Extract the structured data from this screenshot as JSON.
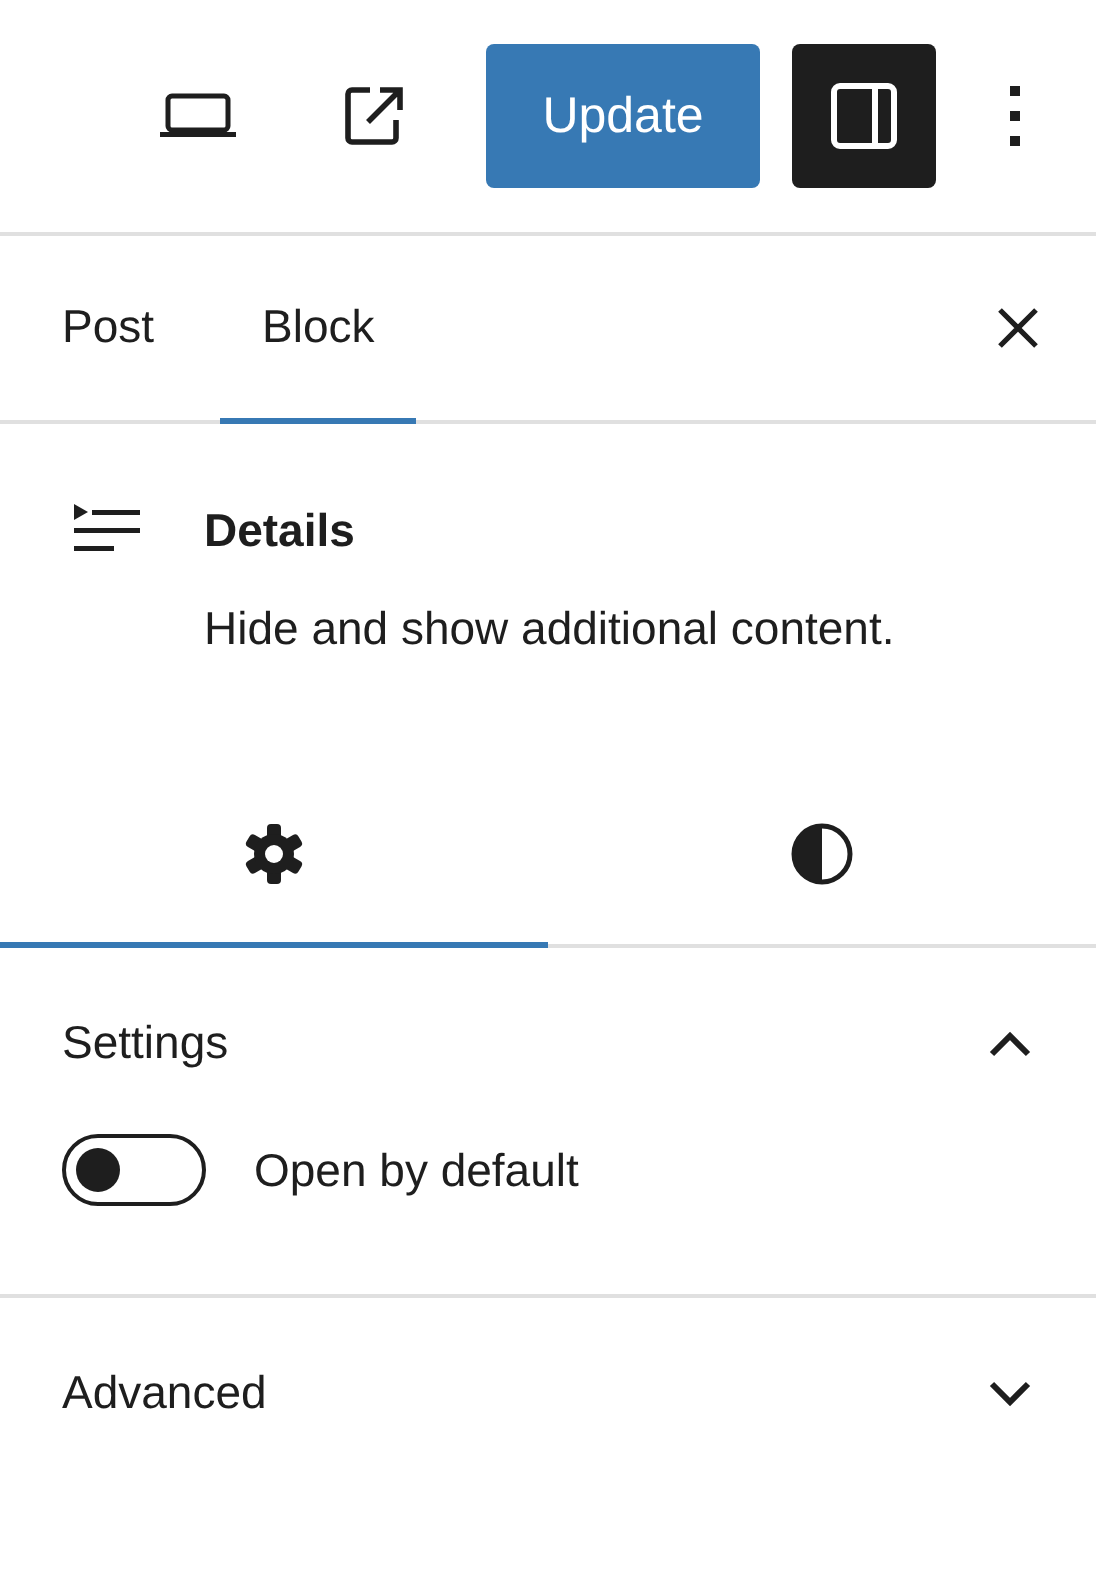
{
  "toolbar": {
    "update_button": "Update",
    "sidebar_toggle": {
      "selected": true
    }
  },
  "sidebar_tabs": [
    {
      "label": "Post",
      "selected": false
    },
    {
      "label": "Block",
      "selected": true
    }
  ],
  "block": {
    "title": "Details",
    "description": "Hide and show additional content."
  },
  "inspector_tabs": [
    {
      "kind": "settings",
      "selected": true
    },
    {
      "kind": "styles",
      "selected": false
    }
  ],
  "panels": [
    {
      "title": "Settings",
      "expanded": true,
      "toggles": [
        {
          "label": "Open by default",
          "on": false
        }
      ]
    },
    {
      "title": "Advanced",
      "expanded": false
    }
  ]
}
